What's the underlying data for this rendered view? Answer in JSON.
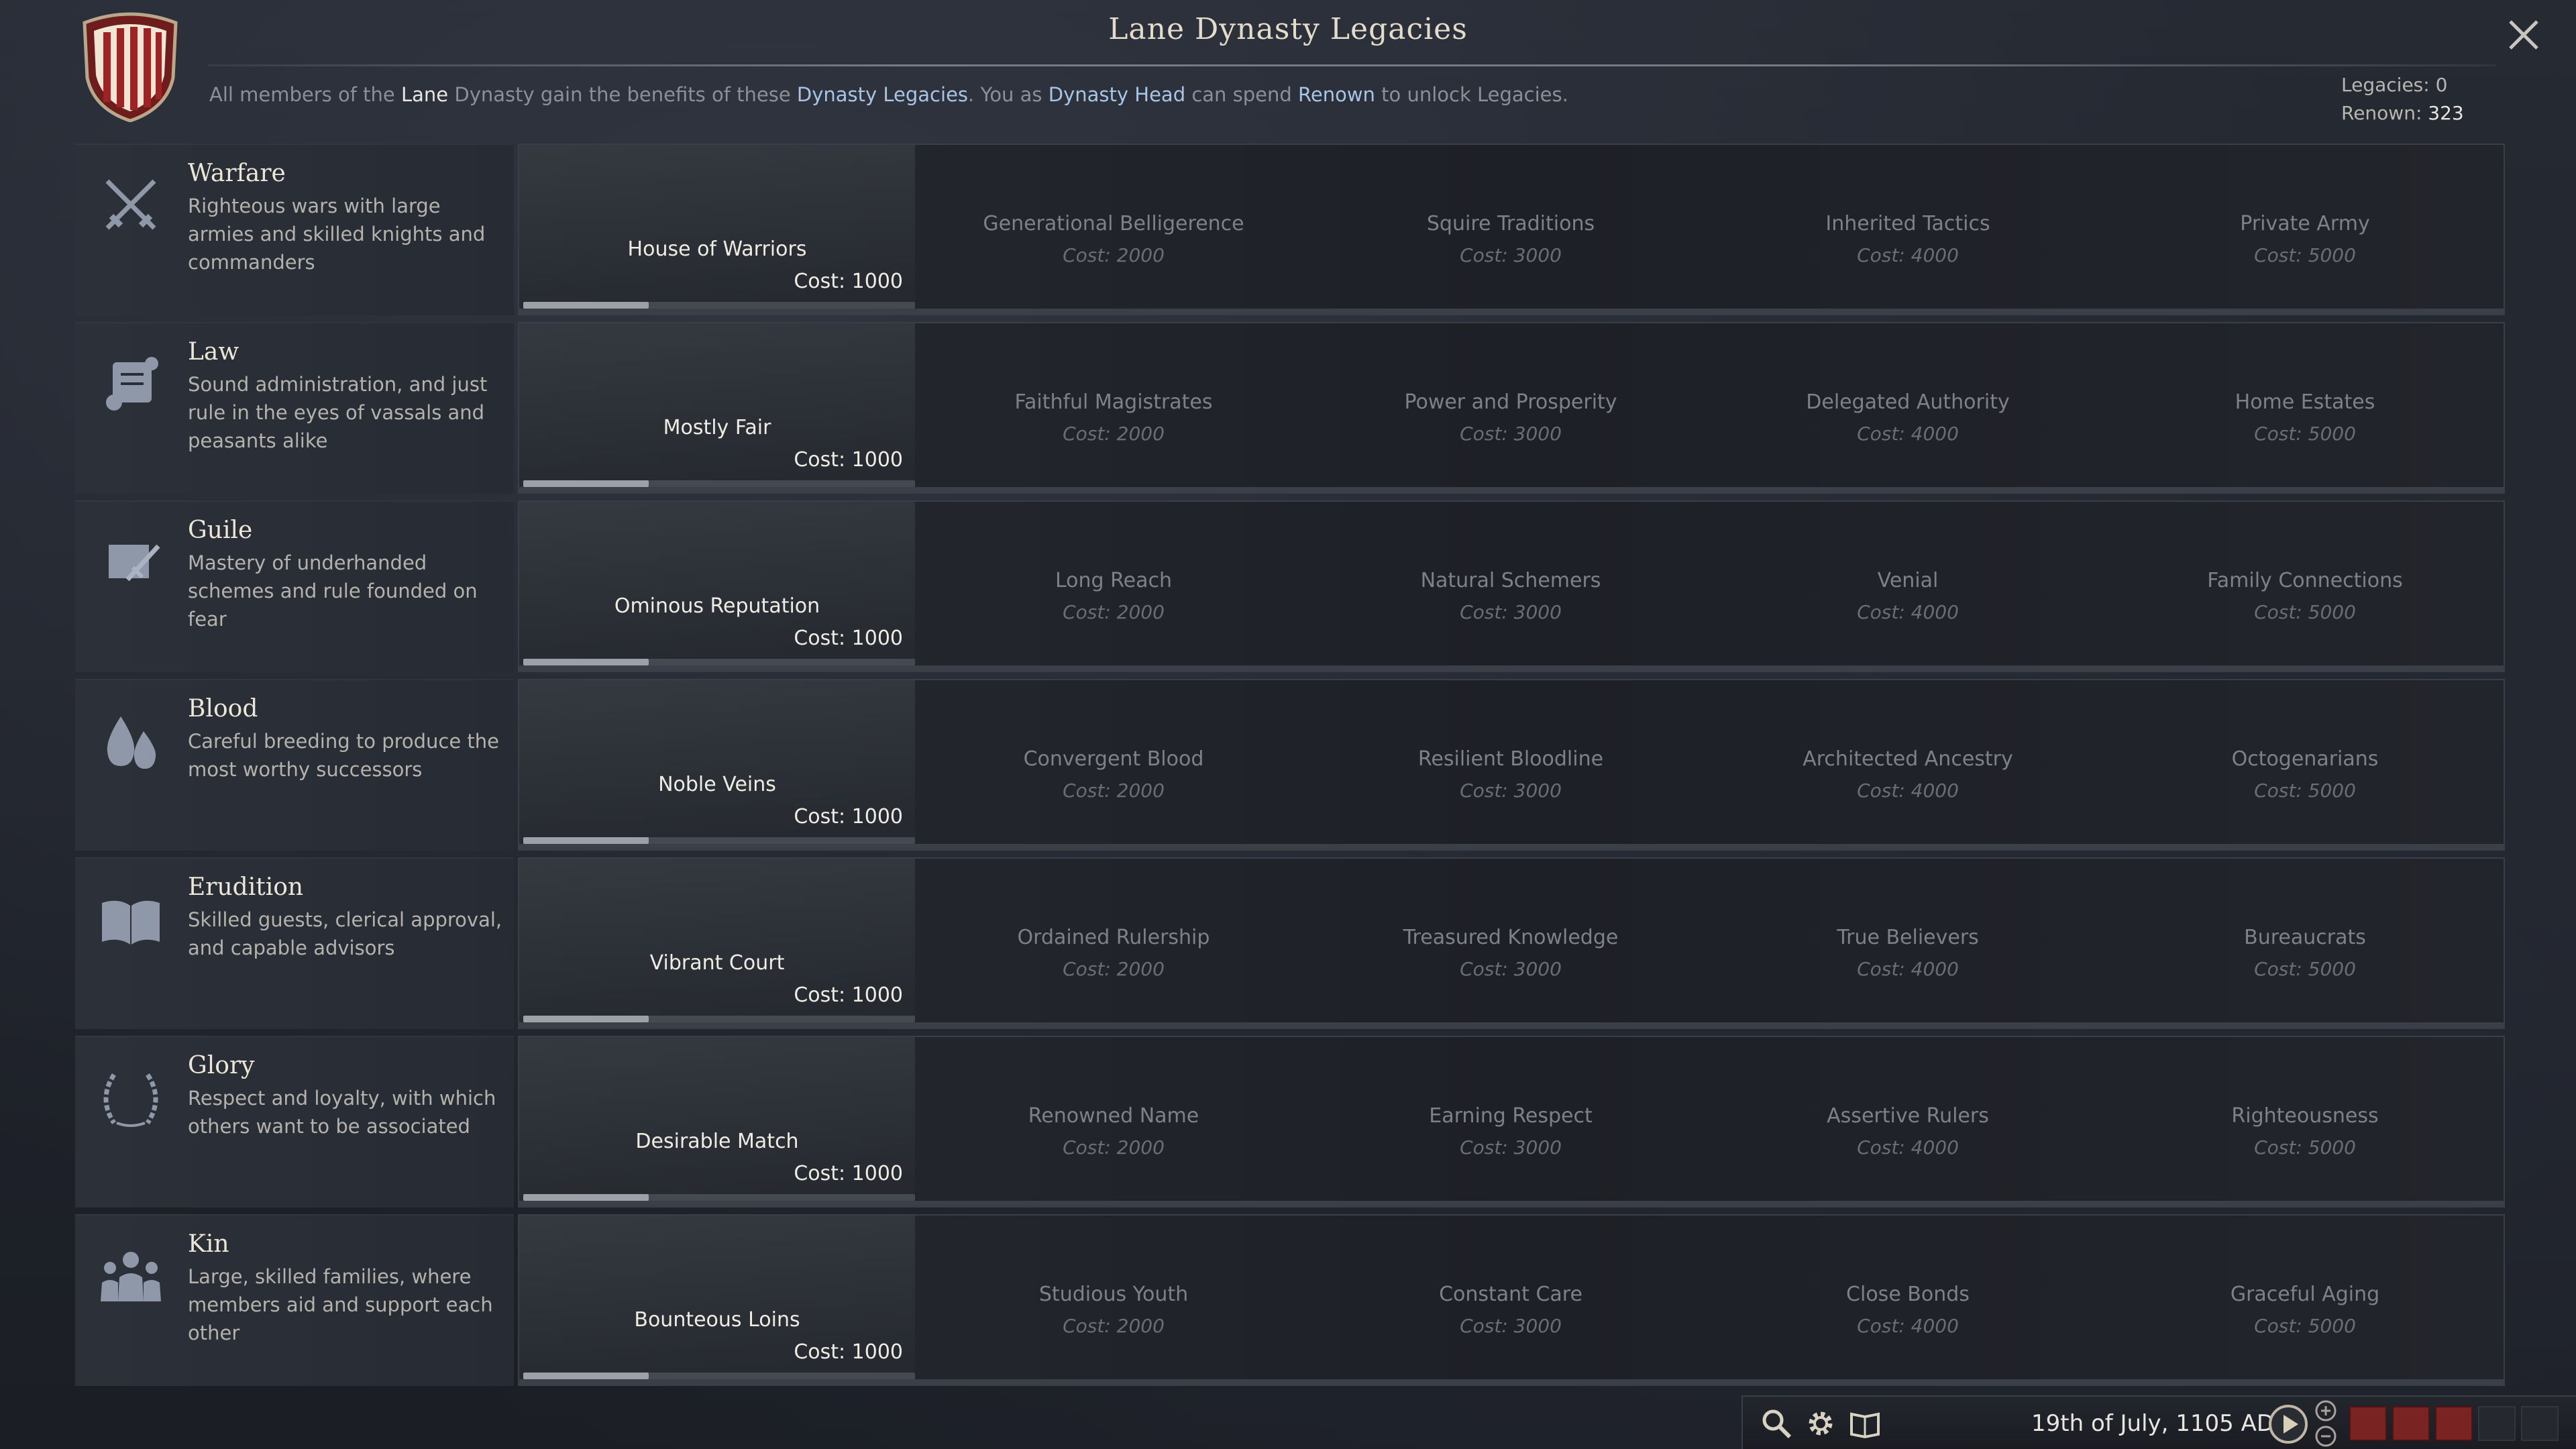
{
  "window": {
    "title": "Lane Dynasty Legacies",
    "intro": {
      "p1": "All members of the ",
      "dynasty": "Lane",
      "p2": " Dynasty gain the benefits of these ",
      "legacies_link": "Dynasty Legacies",
      "p3": ". You as ",
      "head_link": "Dynasty Head",
      "p4": " can spend ",
      "renown_link": "Renown",
      "p5": " to unlock Legacies."
    },
    "stats": {
      "legacies_label": "Legacies:",
      "legacies_value": "0",
      "renown_label": "Renown:",
      "renown_value": "323"
    }
  },
  "colors": {
    "accent_blue": "#a9c5e6",
    "progress_fill": "#9ca0a8",
    "speed_active": "#7a2323"
  },
  "categories": [
    {
      "name": "Warfare",
      "icon": "crossed-swords-icon",
      "description": "Righteous wars with large armies and skilled knights and commanders",
      "progress": 0.32,
      "legacies": [
        {
          "name": "House of Warriors",
          "cost": "Cost: 1000"
        },
        {
          "name": "Generational Belligerence",
          "cost": "Cost: 2000"
        },
        {
          "name": "Squire Traditions",
          "cost": "Cost: 3000"
        },
        {
          "name": "Inherited Tactics",
          "cost": "Cost: 4000"
        },
        {
          "name": "Private Army",
          "cost": "Cost: 5000"
        }
      ]
    },
    {
      "name": "Law",
      "icon": "scroll-icon",
      "description": "Sound administration, and just rule in the eyes of vassals and peasants alike",
      "progress": 0.32,
      "legacies": [
        {
          "name": "Mostly Fair",
          "cost": "Cost: 1000"
        },
        {
          "name": "Faithful Magistrates",
          "cost": "Cost: 2000"
        },
        {
          "name": "Power and Prosperity",
          "cost": "Cost: 3000"
        },
        {
          "name": "Delegated Authority",
          "cost": "Cost: 4000"
        },
        {
          "name": "Home Estates",
          "cost": "Cost: 5000"
        }
      ]
    },
    {
      "name": "Guile",
      "icon": "dagger-scroll-icon",
      "description": "Mastery of underhanded schemes and rule founded on fear",
      "progress": 0.32,
      "legacies": [
        {
          "name": "Ominous Reputation",
          "cost": "Cost: 1000"
        },
        {
          "name": "Long Reach",
          "cost": "Cost: 2000"
        },
        {
          "name": "Natural Schemers",
          "cost": "Cost: 3000"
        },
        {
          "name": "Venial",
          "cost": "Cost: 4000"
        },
        {
          "name": "Family Connections",
          "cost": "Cost: 5000"
        }
      ]
    },
    {
      "name": "Blood",
      "icon": "blood-drops-icon",
      "description": "Careful breeding to produce the most worthy successors",
      "progress": 0.32,
      "legacies": [
        {
          "name": "Noble Veins",
          "cost": "Cost: 1000"
        },
        {
          "name": "Convergent Blood",
          "cost": "Cost: 2000"
        },
        {
          "name": "Resilient Bloodline",
          "cost": "Cost: 3000"
        },
        {
          "name": "Architected Ancestry",
          "cost": "Cost: 4000"
        },
        {
          "name": "Octogenarians",
          "cost": "Cost: 5000"
        }
      ]
    },
    {
      "name": "Erudition",
      "icon": "open-book-icon",
      "description": "Skilled guests, clerical approval, and capable advisors",
      "progress": 0.32,
      "legacies": [
        {
          "name": "Vibrant Court",
          "cost": "Cost: 1000"
        },
        {
          "name": "Ordained Rulership",
          "cost": "Cost: 2000"
        },
        {
          "name": "Treasured Knowledge",
          "cost": "Cost: 3000"
        },
        {
          "name": "True Believers",
          "cost": "Cost: 4000"
        },
        {
          "name": "Bureaucrats",
          "cost": "Cost: 5000"
        }
      ]
    },
    {
      "name": "Glory",
      "icon": "laurel-wreath-icon",
      "description": "Respect and loyalty, with which others want to be associated",
      "progress": 0.32,
      "legacies": [
        {
          "name": "Desirable Match",
          "cost": "Cost: 1000"
        },
        {
          "name": "Renowned Name",
          "cost": "Cost: 2000"
        },
        {
          "name": "Earning Respect",
          "cost": "Cost: 3000"
        },
        {
          "name": "Assertive Rulers",
          "cost": "Cost: 4000"
        },
        {
          "name": "Righteousness",
          "cost": "Cost: 5000"
        }
      ]
    },
    {
      "name": "Kin",
      "icon": "family-icon",
      "description": "Large, skilled families, where members aid and support each other",
      "progress": 0.32,
      "legacies": [
        {
          "name": "Bounteous Loins",
          "cost": "Cost: 1000"
        },
        {
          "name": "Studious Youth",
          "cost": "Cost: 2000"
        },
        {
          "name": "Constant Care",
          "cost": "Cost: 3000"
        },
        {
          "name": "Close Bonds",
          "cost": "Cost: 4000"
        },
        {
          "name": "Graceful Aging",
          "cost": "Cost: 5000"
        }
      ]
    }
  ],
  "bottombar": {
    "date": "19th of July, 1105 AD",
    "icons": [
      "search-icon",
      "gear-icon",
      "ledger-icon"
    ],
    "speed_levels_active": 3,
    "speed_levels_total": 5
  }
}
